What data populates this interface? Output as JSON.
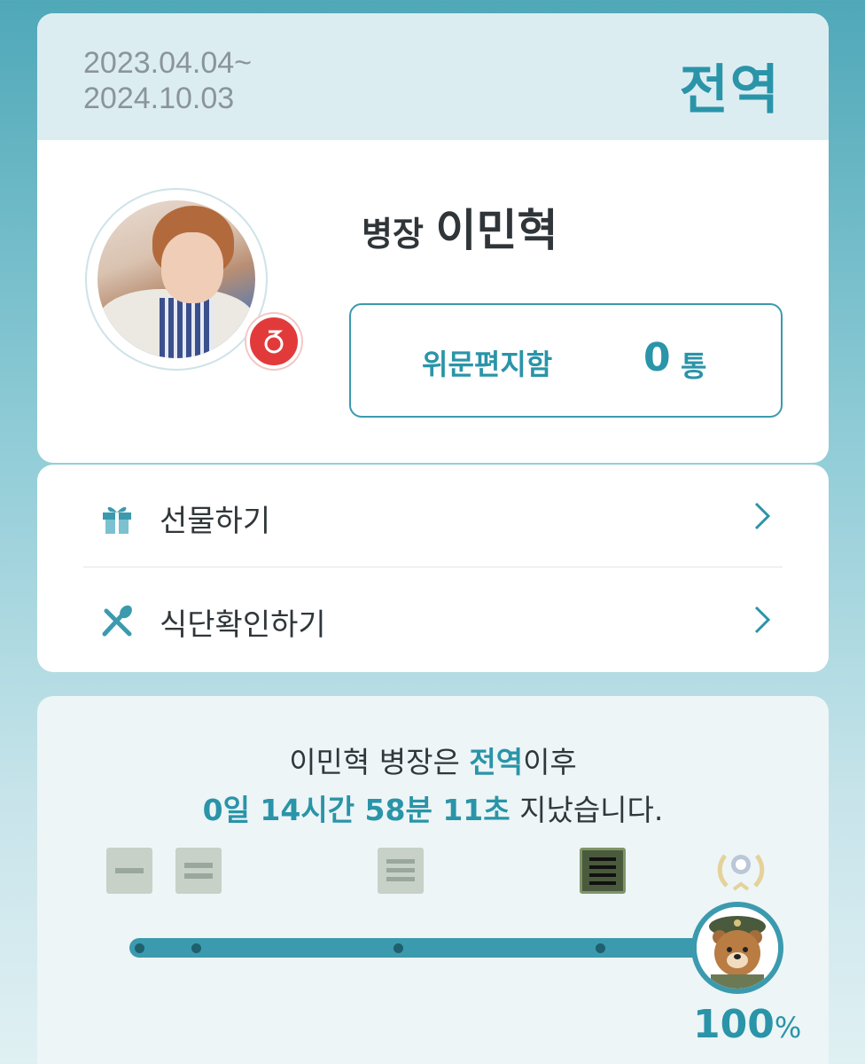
{
  "service": {
    "period_start": "2023.04.04~",
    "period_end": "2024.10.03",
    "status": "전역"
  },
  "profile": {
    "rank": "병장",
    "name": "이민혁",
    "letterbox_label": "위문편지함",
    "letter_count": "0",
    "letter_unit": "통"
  },
  "menu": {
    "items": [
      {
        "label": "선물하기",
        "icon": "gift-icon"
      },
      {
        "label": "식단확인하기",
        "icon": "utensils-icon"
      }
    ]
  },
  "progress": {
    "line1_name": "이민혁 병장은 ",
    "line1_status": "전역",
    "line1_suffix": "이후",
    "line2_elapsed": "0일 14시간 58분 11초",
    "line2_suffix": " 지났습니다.",
    "percent_value": "100",
    "percent_sign": "%",
    "percent": 100,
    "ranks": [
      "private-rank-icon",
      "private-first-class-rank-icon",
      "corporal-rank-icon",
      "sergeant-rank-icon",
      "discharge-wreath-icon"
    ]
  },
  "colors": {
    "accent": "#2a94a8",
    "bar": "#3b9aae",
    "header_bg": "#dcedf2"
  }
}
